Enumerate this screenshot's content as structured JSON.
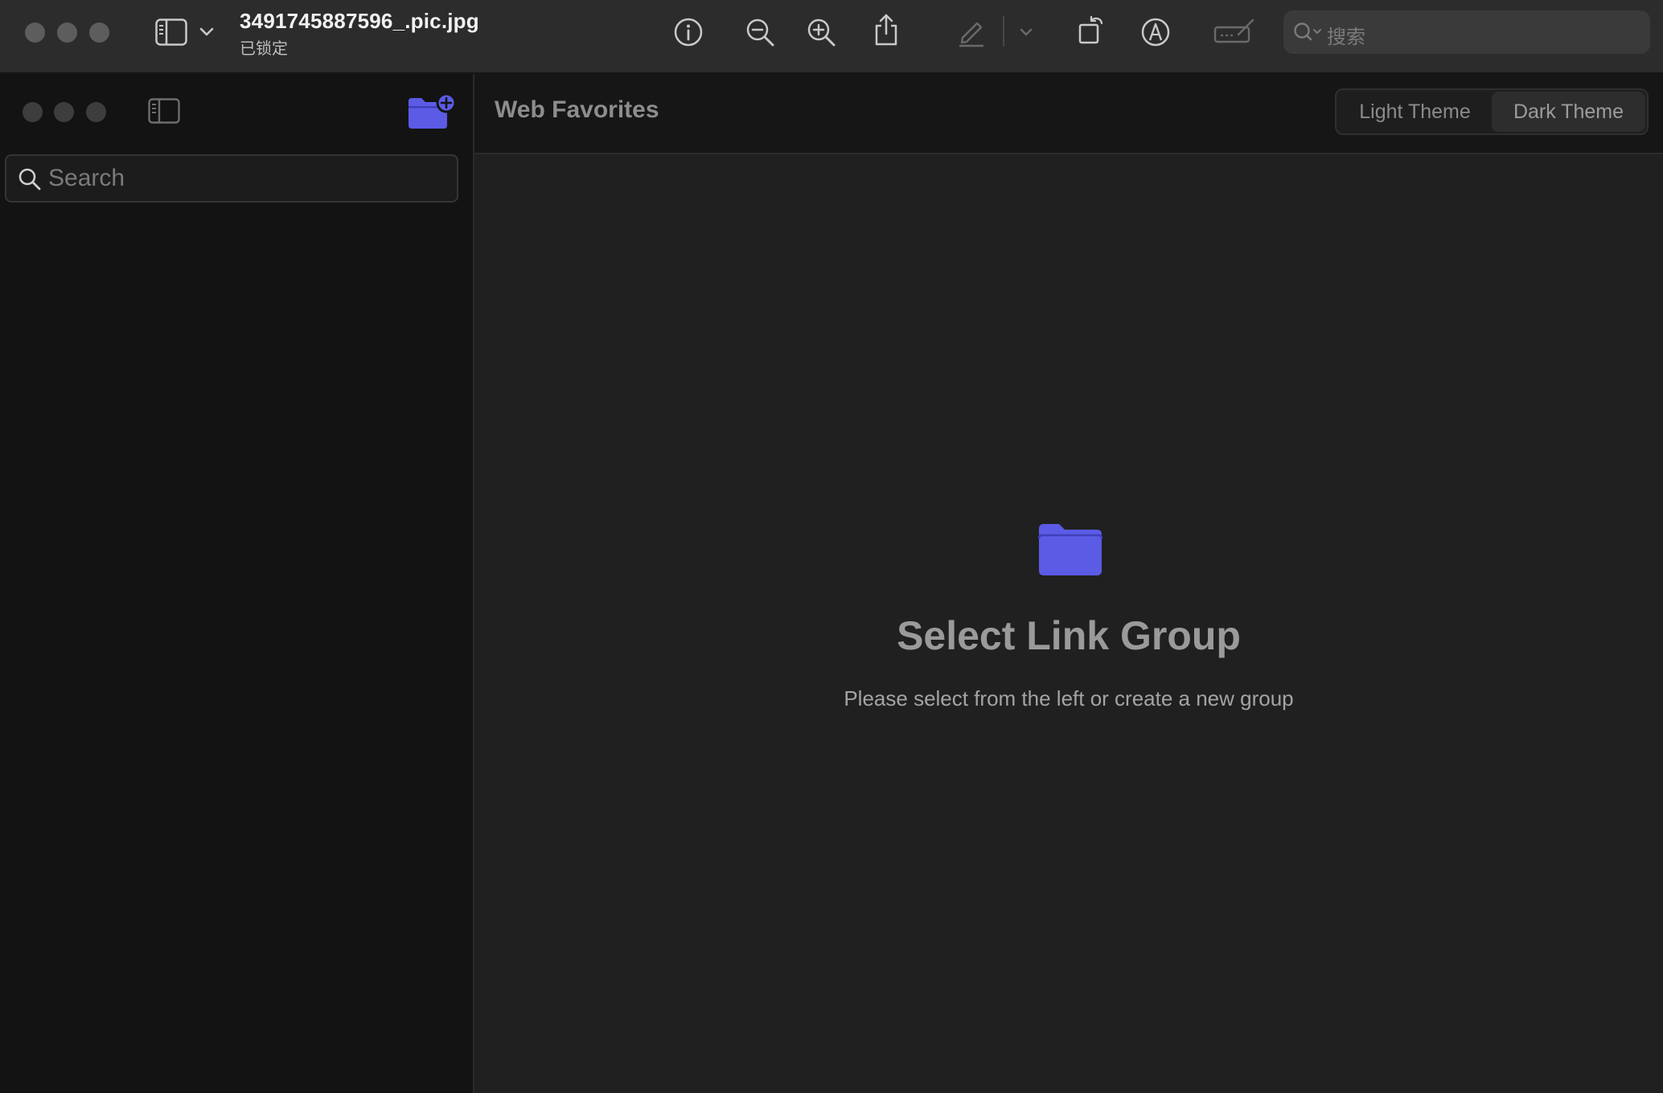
{
  "toolbar": {
    "file_name": "3491745887596_.pic.jpg",
    "file_status": "已锁定",
    "search_placeholder": "搜索"
  },
  "sidebar": {
    "search_placeholder": "Search"
  },
  "content": {
    "title": "Web Favorites",
    "theme_options": [
      "Light Theme",
      "Dark Theme"
    ],
    "active_theme": "Dark Theme",
    "empty_state": {
      "title": "Select Link Group",
      "subtitle": "Please select from the left or create a new group"
    }
  },
  "colors": {
    "accent": "#5b5be6",
    "toolbar_bg": "#2c2c2c",
    "sidebar_bg": "#131313",
    "content_bg": "#202020"
  },
  "icons": {
    "toolbar": [
      "sidebar-toggle-icon",
      "chevron-down-icon",
      "info-icon",
      "zoom-out-icon",
      "zoom-in-icon",
      "share-icon",
      "highlight-pen-icon",
      "rotate-icon",
      "markup-icon",
      "sign-icon",
      "search-icon"
    ],
    "sidebar": [
      "sidebar-toggle-icon",
      "new-folder-icon",
      "search-icon"
    ],
    "content": [
      "folder-icon"
    ]
  }
}
